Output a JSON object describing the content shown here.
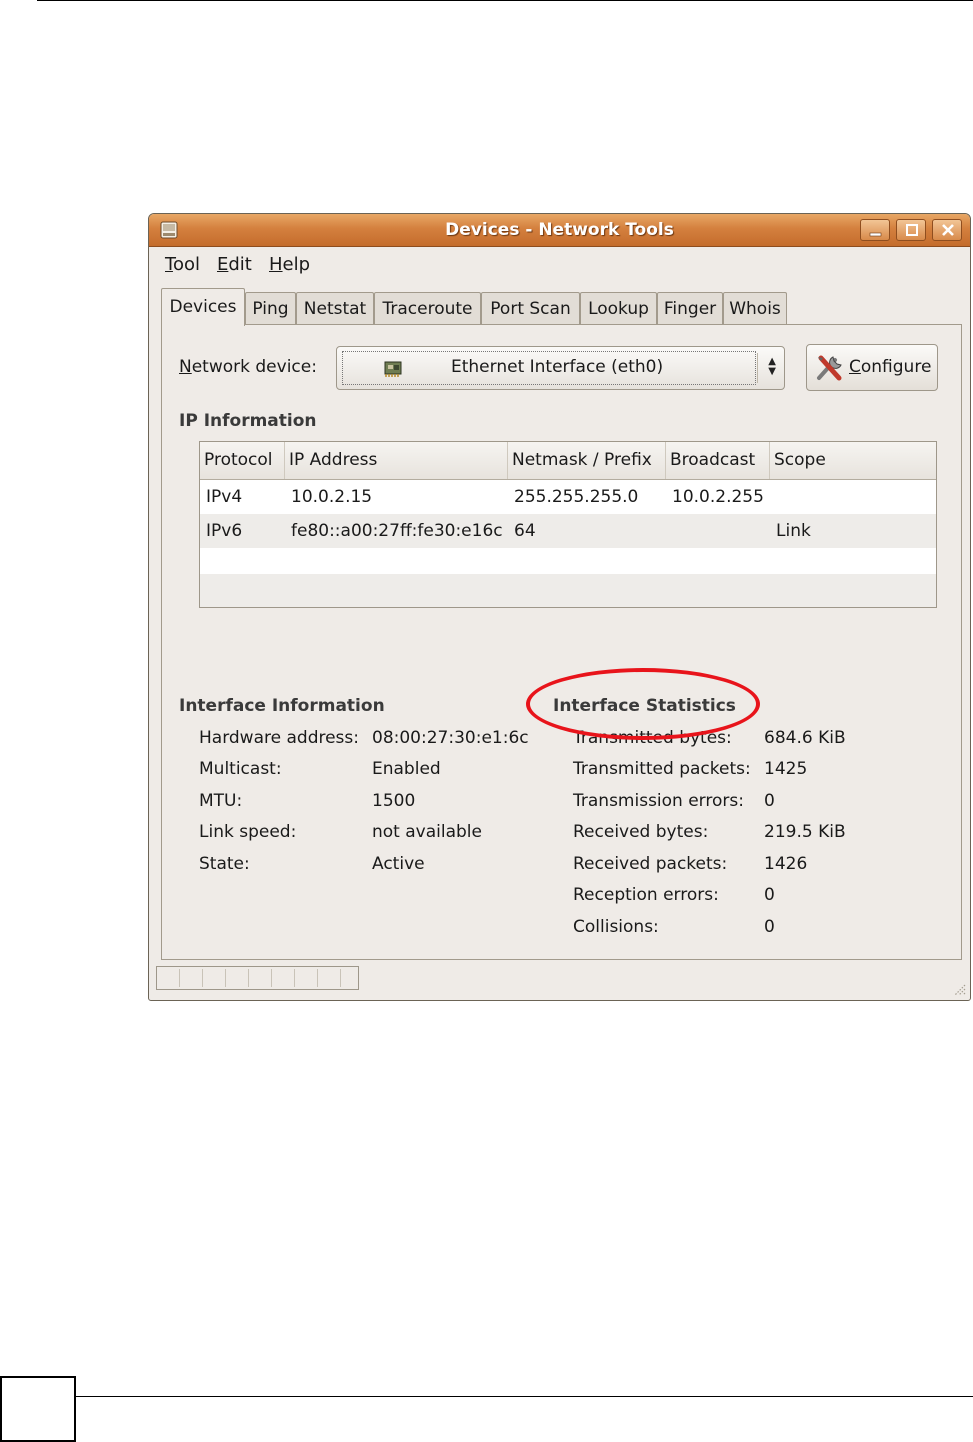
{
  "window": {
    "title": "Devices - Network Tools"
  },
  "menu": [
    {
      "mnemonic": "T",
      "rest": "ool"
    },
    {
      "mnemonic": "E",
      "rest": "dit"
    },
    {
      "mnemonic": "H",
      "rest": "elp"
    }
  ],
  "tabs": [
    "Devices",
    "Ping",
    "Netstat",
    "Traceroute",
    "Port Scan",
    "Lookup",
    "Finger",
    "Whois"
  ],
  "active_tab": "Devices",
  "device": {
    "label_mnemonic": "N",
    "label_rest": "etwork device:",
    "selected": "Ethernet Interface (eth0)",
    "configure_mnemonic": "C",
    "configure_rest": "onfigure"
  },
  "ip_info": {
    "heading": "IP Information",
    "columns": [
      "Protocol",
      "IP Address",
      "Netmask / Prefix",
      "Broadcast",
      "Scope"
    ],
    "rows": [
      [
        "IPv4",
        "10.0.2.15",
        "255.255.255.0",
        "10.0.2.255",
        ""
      ],
      [
        "IPv6",
        "fe80::a00:27ff:fe30:e16c",
        "64",
        "",
        "Link"
      ]
    ]
  },
  "iface_info": {
    "heading": "Interface Information",
    "items": [
      {
        "label": "Hardware address:",
        "value": "08:00:27:30:e1:6c"
      },
      {
        "label": "Multicast:",
        "value": "Enabled"
      },
      {
        "label": "MTU:",
        "value": "1500"
      },
      {
        "label": "Link speed:",
        "value": "not available"
      },
      {
        "label": "State:",
        "value": "Active"
      }
    ]
  },
  "iface_stats": {
    "heading": "Interface Statistics",
    "items": [
      {
        "label": "Transmitted bytes:",
        "value": "684.6 KiB"
      },
      {
        "label": "Transmitted packets:",
        "value": "1425"
      },
      {
        "label": "Transmission errors:",
        "value": "0"
      },
      {
        "label": "Received bytes:",
        "value": "219.5 KiB"
      },
      {
        "label": "Received packets:",
        "value": "1426"
      },
      {
        "label": "Reception errors:",
        "value": "0"
      },
      {
        "label": "Collisions:",
        "value": "0"
      }
    ]
  },
  "colors": {
    "titlebar": "#d4803e",
    "window_bg": "#efebe7",
    "annotation": "#e8141b"
  }
}
